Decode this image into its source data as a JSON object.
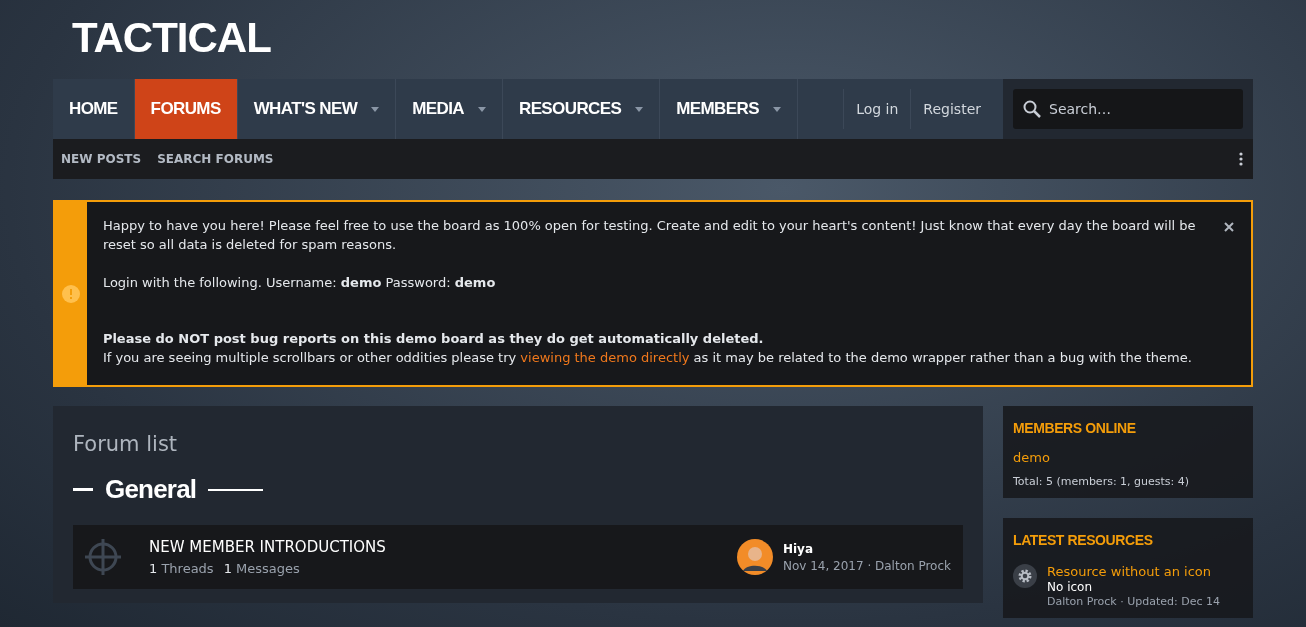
{
  "logo": "TACTICAL",
  "nav": [
    {
      "label": "HOME",
      "selected": false,
      "dropdown": false
    },
    {
      "label": "FORUMS",
      "selected": true,
      "dropdown": false
    },
    {
      "label": "WHAT'S NEW",
      "selected": false,
      "dropdown": true
    },
    {
      "label": "MEDIA",
      "selected": false,
      "dropdown": true
    },
    {
      "label": "RESOURCES",
      "selected": false,
      "dropdown": true
    },
    {
      "label": "MEMBERS",
      "selected": false,
      "dropdown": true
    }
  ],
  "account": [
    "Log in",
    "Register"
  ],
  "search": {
    "placeholder": "Search…"
  },
  "subnav": [
    "NEW POSTS",
    "SEARCH FORUMS"
  ],
  "notice": {
    "paragraphs": [
      "Happy to have you here! Please feel free to use the board as 100% open for testing. Create and edit to your heart's content! Just know that every day the board will be reset so all data is deleted for spam reasons.",
      "Login with the following. Username: **demo** Password: **demo**"
    ],
    "warning": "Please do NOT post bug reports on this demo board as they do get automatically deleted.",
    "tip_before": "If you are seeing multiple scrollbars or other oddities please try",
    "tip_link": "viewing the demo directly",
    "tip_after": "as it may be related to the demo wrapper rather than a bug with the theme."
  },
  "page_title": "Forum list",
  "category": "General",
  "forums": [
    {
      "title": "NEW MEMBER INTRODUCTIONS",
      "threads": "1",
      "threads_label": "Threads",
      "messages": "1",
      "messages_label": "Messages",
      "last_title": "Hiya",
      "last_meta": "Nov 14, 2017 · Dalton Prock"
    }
  ],
  "members_online": {
    "title": "MEMBERS ONLINE",
    "members": [
      "demo"
    ],
    "total": "Total: 5 (members: 1, guests: 4)"
  },
  "latest_resources": {
    "title": "LATEST RESOURCES",
    "items": [
      {
        "title": "Resource without an icon",
        "tagline": "No icon",
        "meta": "Dalton Prock · Updated: Dec 14"
      }
    ]
  }
}
